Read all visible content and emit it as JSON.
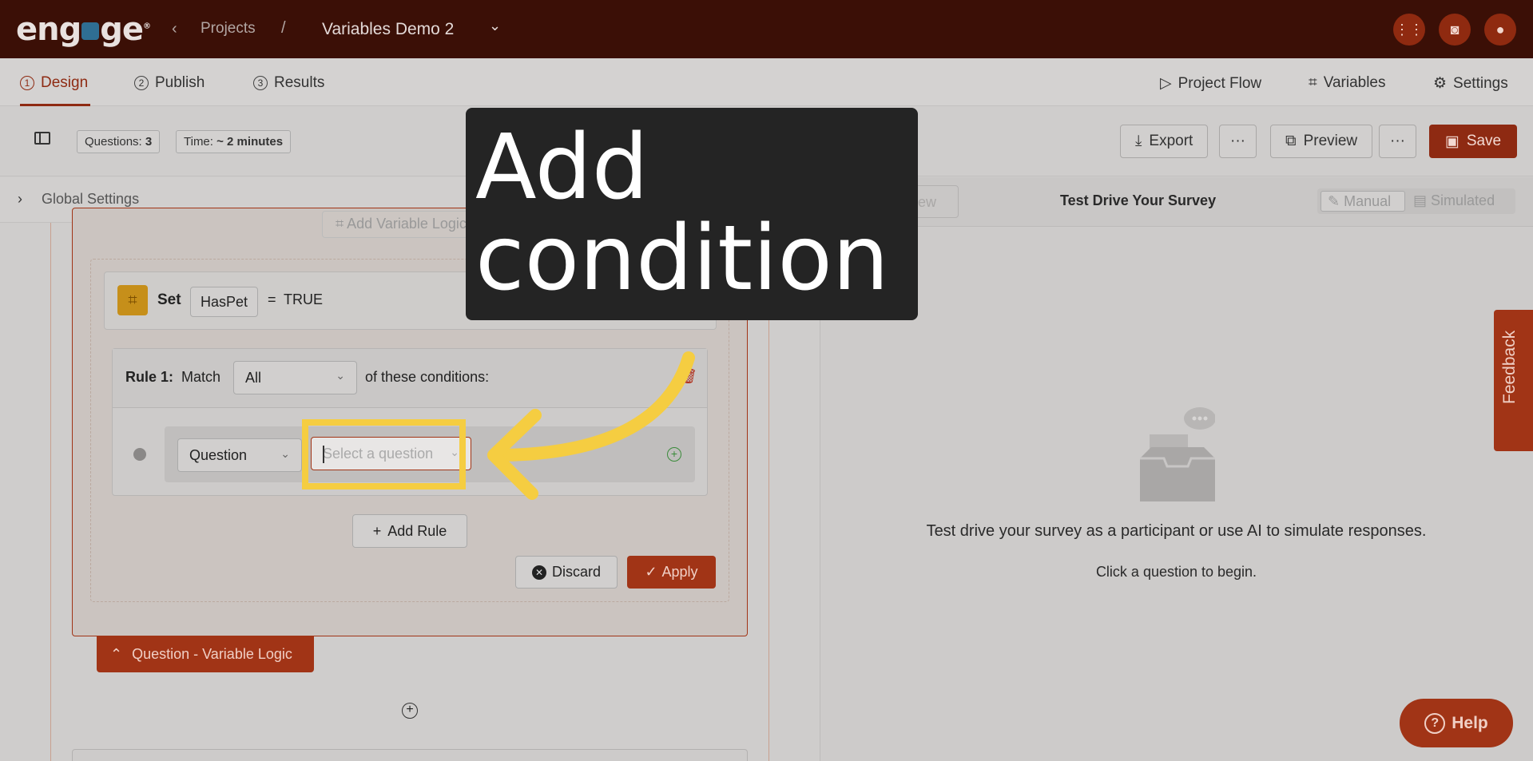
{
  "topbar": {
    "logo": "engage",
    "projects_link": "Projects",
    "separator": "/",
    "project_name": "Variables Demo 2"
  },
  "tabs": [
    {
      "num": "1",
      "label": "Design"
    },
    {
      "num": "2",
      "label": "Publish"
    },
    {
      "num": "3",
      "label": "Results"
    }
  ],
  "top_actions": {
    "project_flow": "Project Flow",
    "variables": "Variables",
    "settings": "Settings"
  },
  "toolbar": {
    "questions_label": "Questions:",
    "questions_value": "3",
    "time_label": "Time:",
    "time_value": "~ 2 minutes",
    "export": "Export",
    "preview": "Preview",
    "save": "Save",
    "more": "···"
  },
  "global_settings": "Global Settings",
  "logic": {
    "add_variable_logic": "Add Variable Logic",
    "set_label": "Set",
    "variable": "HasPet",
    "equals": "=",
    "value": "TRUE",
    "rule_title": "Rule 1:",
    "match_label": "Match",
    "match_value": "All",
    "conditions_text": "of these conditions:",
    "condition_type": "Question",
    "select_placeholder": "Select a question",
    "add_rule": "Add Rule",
    "discard": "Discard",
    "apply": "Apply",
    "section_toggle": "Question - Variable Logic"
  },
  "preview_panel": {
    "new_preview": "New Preview",
    "title": "Test Drive Your Survey",
    "mode_manual": "Manual",
    "mode_simulated": "Simulated",
    "empty_text": "Test drive your survey as a participant or use AI to simulate responses.",
    "empty_sub": "Click a question to begin."
  },
  "feedback": "Feedback",
  "help": "Help",
  "annotation": {
    "line1": "Add",
    "line2": "condition",
    "highlight_color": "#f5cd41"
  }
}
